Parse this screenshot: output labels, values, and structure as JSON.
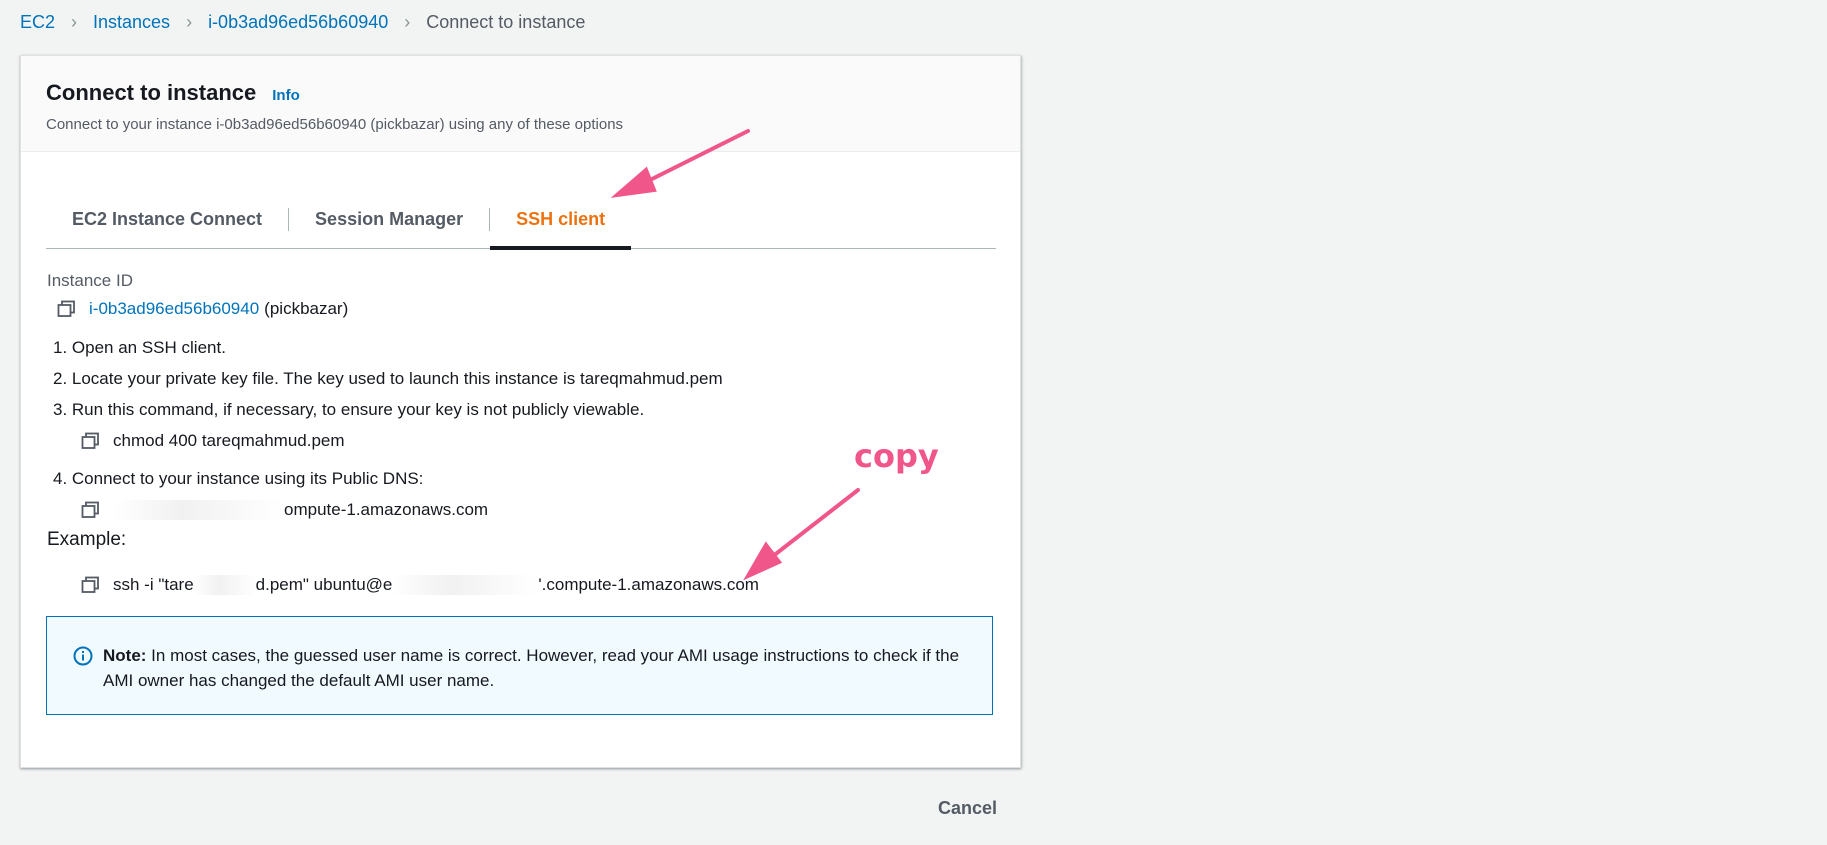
{
  "breadcrumb": {
    "items": [
      "EC2",
      "Instances",
      "i-0b3ad96ed56b60940"
    ],
    "current": "Connect to instance"
  },
  "header": {
    "title": "Connect to instance",
    "info": "Info",
    "subtitle": "Connect to your instance i-0b3ad96ed56b60940 (pickbazar) using any of these options"
  },
  "tabs": [
    {
      "label": "EC2 Instance Connect"
    },
    {
      "label": "Session Manager"
    },
    {
      "label": "SSH client",
      "active": true
    }
  ],
  "ssh": {
    "instance_id_label": "Instance ID",
    "instance_id": "i-0b3ad96ed56b60940",
    "instance_name": "(pickbazar)",
    "step1": "1. Open an SSH client.",
    "step2": "2. Locate your private key file. The key used to launch this instance is tareqmahmud.pem",
    "step3": "3. Run this command, if necessary, to ensure your key is not publicly viewable.",
    "chmod_command": "chmod 400 tareqmahmud.pem",
    "step4": "4. Connect to your instance using its Public DNS:",
    "public_dns_visible": "ompute-1.amazonaws.com",
    "example_label": "Example:",
    "example_part1": "ssh -i \"tare",
    "example_part2": "d.pem\" ubuntu@e",
    "example_part3": "'.compute-1.amazonaws.com"
  },
  "note": {
    "bold": "Note:",
    "text": " In most cases, the guessed user name is correct. However, read your AMI usage instructions to check if the AMI owner has changed the default AMI user name."
  },
  "footer": {
    "cancel_label": "Cancel"
  },
  "annotation": {
    "copy_label": "copy"
  },
  "colors": {
    "link": "#0073bb",
    "active_tab": "#ec7211",
    "annotation": "#f0568a"
  },
  "icons": [
    "copy-icon",
    "info-circle-icon",
    "chevron-right-icon"
  ]
}
